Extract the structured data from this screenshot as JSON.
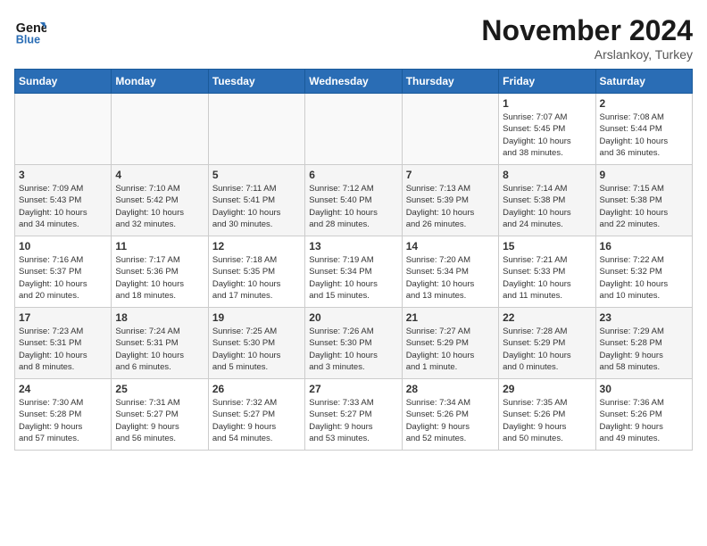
{
  "header": {
    "logo_line1": "General",
    "logo_line2": "Blue",
    "month_title": "November 2024",
    "location": "Arslankoy, Turkey"
  },
  "weekdays": [
    "Sunday",
    "Monday",
    "Tuesday",
    "Wednesday",
    "Thursday",
    "Friday",
    "Saturday"
  ],
  "weeks": [
    [
      {
        "day": "",
        "info": ""
      },
      {
        "day": "",
        "info": ""
      },
      {
        "day": "",
        "info": ""
      },
      {
        "day": "",
        "info": ""
      },
      {
        "day": "",
        "info": ""
      },
      {
        "day": "1",
        "info": "Sunrise: 7:07 AM\nSunset: 5:45 PM\nDaylight: 10 hours\nand 38 minutes."
      },
      {
        "day": "2",
        "info": "Sunrise: 7:08 AM\nSunset: 5:44 PM\nDaylight: 10 hours\nand 36 minutes."
      }
    ],
    [
      {
        "day": "3",
        "info": "Sunrise: 7:09 AM\nSunset: 5:43 PM\nDaylight: 10 hours\nand 34 minutes."
      },
      {
        "day": "4",
        "info": "Sunrise: 7:10 AM\nSunset: 5:42 PM\nDaylight: 10 hours\nand 32 minutes."
      },
      {
        "day": "5",
        "info": "Sunrise: 7:11 AM\nSunset: 5:41 PM\nDaylight: 10 hours\nand 30 minutes."
      },
      {
        "day": "6",
        "info": "Sunrise: 7:12 AM\nSunset: 5:40 PM\nDaylight: 10 hours\nand 28 minutes."
      },
      {
        "day": "7",
        "info": "Sunrise: 7:13 AM\nSunset: 5:39 PM\nDaylight: 10 hours\nand 26 minutes."
      },
      {
        "day": "8",
        "info": "Sunrise: 7:14 AM\nSunset: 5:38 PM\nDaylight: 10 hours\nand 24 minutes."
      },
      {
        "day": "9",
        "info": "Sunrise: 7:15 AM\nSunset: 5:38 PM\nDaylight: 10 hours\nand 22 minutes."
      }
    ],
    [
      {
        "day": "10",
        "info": "Sunrise: 7:16 AM\nSunset: 5:37 PM\nDaylight: 10 hours\nand 20 minutes."
      },
      {
        "day": "11",
        "info": "Sunrise: 7:17 AM\nSunset: 5:36 PM\nDaylight: 10 hours\nand 18 minutes."
      },
      {
        "day": "12",
        "info": "Sunrise: 7:18 AM\nSunset: 5:35 PM\nDaylight: 10 hours\nand 17 minutes."
      },
      {
        "day": "13",
        "info": "Sunrise: 7:19 AM\nSunset: 5:34 PM\nDaylight: 10 hours\nand 15 minutes."
      },
      {
        "day": "14",
        "info": "Sunrise: 7:20 AM\nSunset: 5:34 PM\nDaylight: 10 hours\nand 13 minutes."
      },
      {
        "day": "15",
        "info": "Sunrise: 7:21 AM\nSunset: 5:33 PM\nDaylight: 10 hours\nand 11 minutes."
      },
      {
        "day": "16",
        "info": "Sunrise: 7:22 AM\nSunset: 5:32 PM\nDaylight: 10 hours\nand 10 minutes."
      }
    ],
    [
      {
        "day": "17",
        "info": "Sunrise: 7:23 AM\nSunset: 5:31 PM\nDaylight: 10 hours\nand 8 minutes."
      },
      {
        "day": "18",
        "info": "Sunrise: 7:24 AM\nSunset: 5:31 PM\nDaylight: 10 hours\nand 6 minutes."
      },
      {
        "day": "19",
        "info": "Sunrise: 7:25 AM\nSunset: 5:30 PM\nDaylight: 10 hours\nand 5 minutes."
      },
      {
        "day": "20",
        "info": "Sunrise: 7:26 AM\nSunset: 5:30 PM\nDaylight: 10 hours\nand 3 minutes."
      },
      {
        "day": "21",
        "info": "Sunrise: 7:27 AM\nSunset: 5:29 PM\nDaylight: 10 hours\nand 1 minute."
      },
      {
        "day": "22",
        "info": "Sunrise: 7:28 AM\nSunset: 5:29 PM\nDaylight: 10 hours\nand 0 minutes."
      },
      {
        "day": "23",
        "info": "Sunrise: 7:29 AM\nSunset: 5:28 PM\nDaylight: 9 hours\nand 58 minutes."
      }
    ],
    [
      {
        "day": "24",
        "info": "Sunrise: 7:30 AM\nSunset: 5:28 PM\nDaylight: 9 hours\nand 57 minutes."
      },
      {
        "day": "25",
        "info": "Sunrise: 7:31 AM\nSunset: 5:27 PM\nDaylight: 9 hours\nand 56 minutes."
      },
      {
        "day": "26",
        "info": "Sunrise: 7:32 AM\nSunset: 5:27 PM\nDaylight: 9 hours\nand 54 minutes."
      },
      {
        "day": "27",
        "info": "Sunrise: 7:33 AM\nSunset: 5:27 PM\nDaylight: 9 hours\nand 53 minutes."
      },
      {
        "day": "28",
        "info": "Sunrise: 7:34 AM\nSunset: 5:26 PM\nDaylight: 9 hours\nand 52 minutes."
      },
      {
        "day": "29",
        "info": "Sunrise: 7:35 AM\nSunset: 5:26 PM\nDaylight: 9 hours\nand 50 minutes."
      },
      {
        "day": "30",
        "info": "Sunrise: 7:36 AM\nSunset: 5:26 PM\nDaylight: 9 hours\nand 49 minutes."
      }
    ]
  ]
}
